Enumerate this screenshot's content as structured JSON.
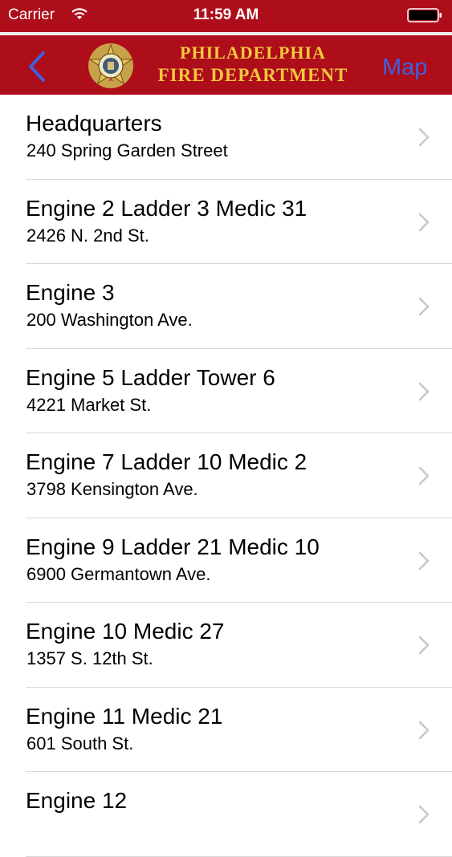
{
  "status": {
    "carrier": "Carrier",
    "time": "11:59 AM"
  },
  "nav": {
    "title_line1": "PHILADELPHIA",
    "title_line2": "FIRE DEPARTMENT",
    "map_label": "Map"
  },
  "colors": {
    "header": "#ae0d1a",
    "title_gold": "#f3c93c",
    "link_blue": "#3e61e0"
  },
  "stations": [
    {
      "name": "Headquarters",
      "address": "240 Spring Garden Street"
    },
    {
      "name": "Engine 2 Ladder 3 Medic 31",
      "address": "2426 N. 2nd St."
    },
    {
      "name": "Engine 3",
      "address": "200 Washington Ave."
    },
    {
      "name": "Engine 5 Ladder Tower 6",
      "address": "4221 Market St."
    },
    {
      "name": "Engine 7 Ladder 10 Medic 2",
      "address": "3798 Kensington Ave."
    },
    {
      "name": "Engine 9 Ladder 21 Medic 10",
      "address": "6900 Germantown Ave."
    },
    {
      "name": "Engine 10 Medic 27",
      "address": "1357 S. 12th St."
    },
    {
      "name": "Engine 11 Medic 21",
      "address": "601 South St."
    },
    {
      "name": "Engine 12",
      "address": ""
    }
  ]
}
